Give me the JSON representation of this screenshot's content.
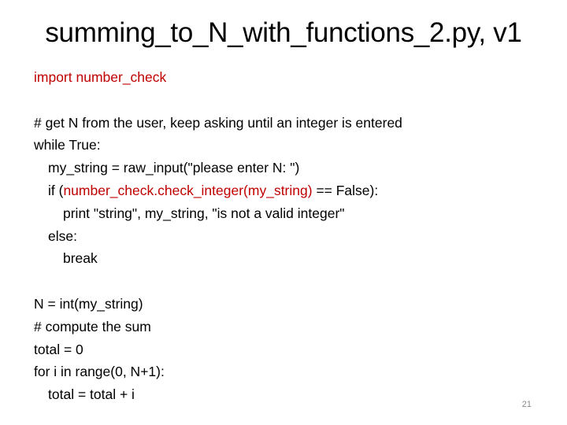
{
  "slide": {
    "title": "summing_to_N_with_functions_2.py, v1",
    "page_number": "21",
    "accent_color": "#c00000",
    "code": {
      "l1": "import number_check",
      "l2": "",
      "l3": "# get N from the user, keep asking until an integer is entered",
      "l4": "while True:",
      "l5": "my_string = raw_input(\"please enter N: \")",
      "l6_a": "if (",
      "l6_b": "number_check.check_integer(my_string)",
      "l6_c": " == False):",
      "l7": "print \"string\", my_string, \"is not a valid integer\"",
      "l8": "else:",
      "l9": "break",
      "l10": "",
      "l11": "N = int(my_string)",
      "l12": "# compute the sum",
      "l13": "total = 0",
      "l14": "for i in range(0, N+1):",
      "l15": "total = total + i"
    }
  }
}
